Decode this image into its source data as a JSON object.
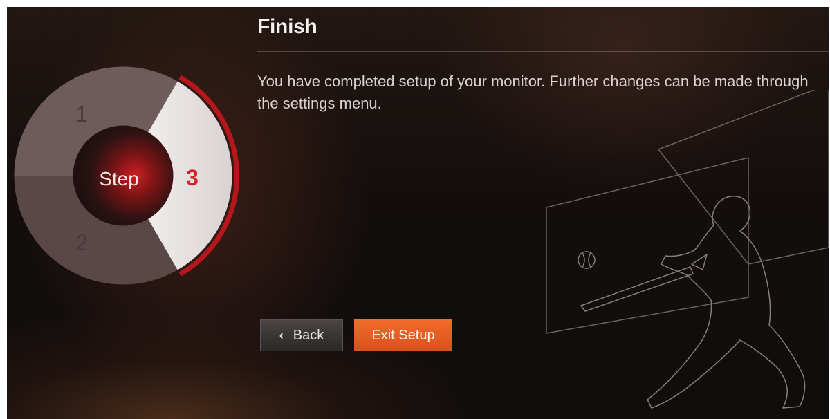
{
  "header": {
    "title": "Finish"
  },
  "content": {
    "description": "You have completed setup of your monitor. Further changes can be made through the settings menu."
  },
  "stepper": {
    "center_label": "Step",
    "steps": [
      {
        "label": "1",
        "state": "complete"
      },
      {
        "label": "2",
        "state": "complete"
      },
      {
        "label": "3",
        "state": "active"
      }
    ],
    "active_color": "#d5232a"
  },
  "buttons": {
    "back_icon": "chevron-left-icon",
    "back_glyph": "‹",
    "back_label": "Back",
    "exit_label": "Exit Setup",
    "exit_color": "#ef6328"
  },
  "illustration": {
    "icon": "baseball-batter-icon"
  }
}
